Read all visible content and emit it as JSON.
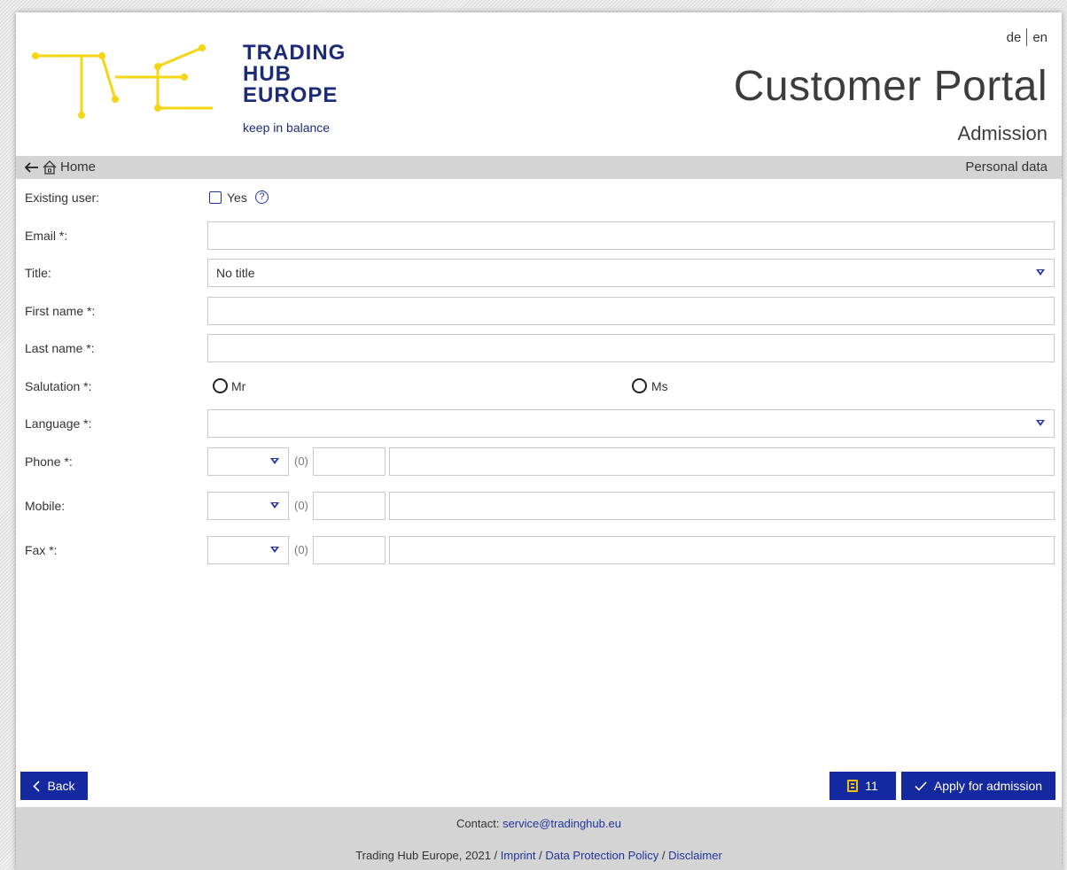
{
  "header": {
    "lang_de": "de",
    "lang_en": "en",
    "title": "Customer Portal",
    "subtitle": "Admission",
    "logo": {
      "line1": "TRADING",
      "line2": "HUB",
      "line3": "EUROPE",
      "tagline": "keep in balance"
    }
  },
  "breadcrumb": {
    "home_label": "Home",
    "section": "Personal data"
  },
  "form": {
    "existing_user": {
      "label": "Existing user:",
      "checkbox_label": "Yes",
      "help": "?"
    },
    "email": {
      "label": "Email *:",
      "value": ""
    },
    "title": {
      "label": "Title:",
      "value": "No title"
    },
    "first_name": {
      "label": "First name *:",
      "value": ""
    },
    "last_name": {
      "label": "Last name *:",
      "value": ""
    },
    "salutation": {
      "label": "Salutation *:",
      "option_mr": "Mr",
      "option_ms": "Ms"
    },
    "language": {
      "label": "Language *:",
      "value": ""
    },
    "phone": {
      "label": "Phone *:",
      "zero": "(0)"
    },
    "mobile": {
      "label": "Mobile:",
      "zero": "(0)"
    },
    "fax": {
      "label": "Fax *:",
      "zero": "(0)"
    }
  },
  "actions": {
    "back": "Back",
    "tasks_count": "11",
    "apply": "Apply for admission"
  },
  "footer": {
    "contact_prefix": "Contact: ",
    "contact_email": "service@tradinghub.eu",
    "copyright": "Trading Hub Europe, 2021 / ",
    "imprint": "Imprint",
    "sep1": " / ",
    "data_protection": "Data Protection Policy",
    "sep2": " / ",
    "disclaimer": "Disclaimer"
  },
  "colors": {
    "brand_blue": "#1428a0",
    "logo_yellow": "#f5d514",
    "logo_navy": "#1b2b78"
  }
}
